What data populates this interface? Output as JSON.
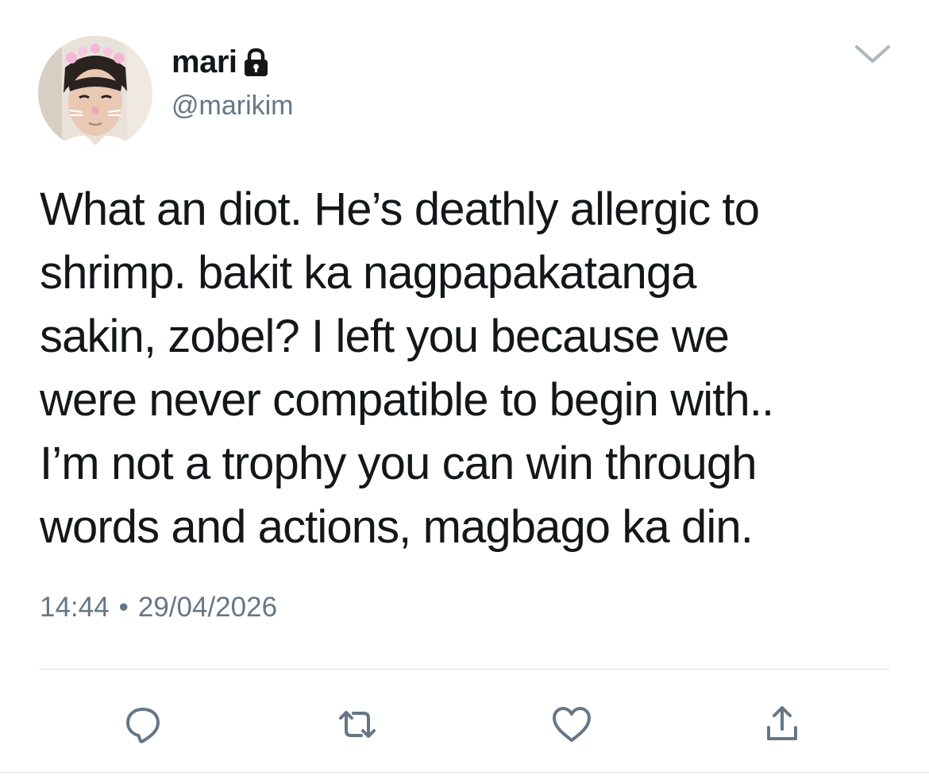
{
  "tweet": {
    "author": {
      "display_name": "mari",
      "handle": "@marikim",
      "protected_icon": "lock-icon",
      "avatar": "avatar"
    },
    "text": "What an diot. He’s deathly allergic to\nshrimp. bakit ka nagpapakatanga\nsakin, zobel? I left you because we\nwere never compatible to begin with..\nI’m not a trophy you can win through\nwords and actions, magbago ka din.",
    "time": "14:44",
    "separator": "•",
    "date": "29/04/2026",
    "menu_icon": "chevron-down-icon",
    "actions": [
      {
        "name": "reply",
        "icon": "reply-icon"
      },
      {
        "name": "retweet",
        "icon": "retweet-icon"
      },
      {
        "name": "like",
        "icon": "heart-icon"
      },
      {
        "name": "share",
        "icon": "share-icon"
      }
    ]
  },
  "colors": {
    "text": "#14171a",
    "secondary": "#657786",
    "icon": "#657786",
    "divider": "#d8dde2",
    "background": "#ffffff"
  }
}
